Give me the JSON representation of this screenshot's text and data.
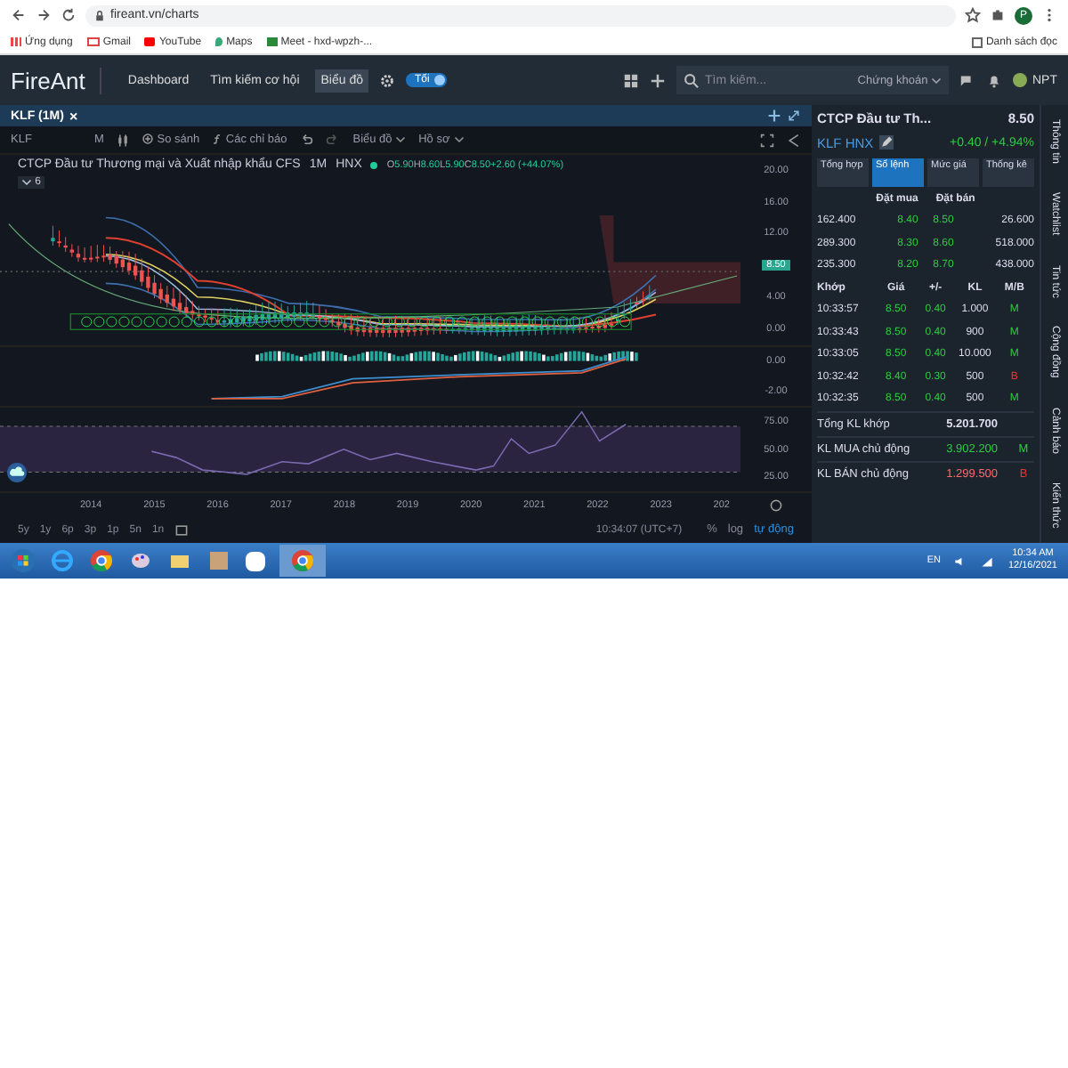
{
  "browser": {
    "url": "fireant.vn/charts",
    "profile": "P",
    "bookmarks": [
      {
        "label": "Ứng dụng",
        "kind": "apps"
      },
      {
        "label": "Gmail",
        "kind": "gmail"
      },
      {
        "label": "YouTube",
        "kind": "youtube"
      },
      {
        "label": "Maps",
        "kind": "maps"
      },
      {
        "label": "Meet - hxd-wpzh-...",
        "kind": "meet"
      }
    ],
    "reading_list": "Danh sách đọc"
  },
  "header": {
    "logo": "FireAnt",
    "nav": [
      {
        "label": "Dashboard",
        "selected": false
      },
      {
        "label": "Tìm kiếm cơ hội",
        "selected": false
      },
      {
        "label": "Biểu đồ",
        "selected": true
      }
    ],
    "theme_toggle": {
      "label": "Tối",
      "on": true
    },
    "search": {
      "placeholder": "Tìm kiếm..."
    },
    "market_select": "Chứng khoán",
    "user": "NPT"
  },
  "chart_tab": {
    "label": "KLF (1M)",
    "close": "×"
  },
  "toolbar": {
    "symbol": "KLF",
    "interval": "M",
    "compare": "So sánh",
    "indicators": "Các chỉ báo",
    "chart_type": "Biểu đồ",
    "profile": "Hồ sơ"
  },
  "chart": {
    "legend": {
      "title": "CTCP Đầu tư Thương mại và Xuất nhập khẩu CFS",
      "interval": "1M",
      "exchange": "HNX",
      "ohlc": [
        {
          "label": "O",
          "value": "5.90"
        },
        {
          "label": "H",
          "value": "8.60"
        },
        {
          "label": "L",
          "value": "5.90"
        },
        {
          "label": "C",
          "value": "8.50"
        }
      ],
      "change": "+2.60 (+44.07%)"
    },
    "collapse": "6",
    "price_axis": [
      {
        "label": "20.00",
        "kind": "tick"
      },
      {
        "label": "16.00",
        "kind": "tick"
      },
      {
        "label": "12.00",
        "kind": "tick"
      },
      {
        "label": "8.50",
        "kind": "current"
      },
      {
        "label": "4.00",
        "kind": "tick"
      },
      {
        "label": "0.00",
        "kind": "tick"
      }
    ],
    "macd_axis": [
      "0.00",
      "-2.00"
    ],
    "rsi_axis": [
      "75.00",
      "50.00",
      "25.00"
    ],
    "time_axis": [
      "2014",
      "2015",
      "2016",
      "2017",
      "2018",
      "2019",
      "2020",
      "2021",
      "2022",
      "2023",
      "202"
    ]
  },
  "bottom_bar": {
    "ranges": [
      "5y",
      "1y",
      "6p",
      "3p",
      "1p",
      "5n",
      "1n"
    ],
    "clock": "10:34:07 (UTC+7)",
    "options": [
      {
        "label": "%",
        "selected": false
      },
      {
        "label": "log",
        "selected": false
      },
      {
        "label": "tự động",
        "selected": true
      }
    ]
  },
  "panel": {
    "name": "CTCP Đầu tư Th...",
    "price": "8.50",
    "symbol": "KLF HNX",
    "change": "+0.40 / +4.94%",
    "tabs": [
      {
        "label": "Tổng hợp",
        "selected": false
      },
      {
        "label": "Sổ lệnh",
        "selected": true
      },
      {
        "label": "Mức giá",
        "selected": false
      },
      {
        "label": "Thống kê",
        "selected": false
      }
    ],
    "book_headers": [
      "Đặt mua",
      "Đặt bán"
    ],
    "book": [
      {
        "bid_volume": "162.400",
        "bid": "8.40",
        "ask": "8.50",
        "ask_volume": "26.600"
      },
      {
        "bid_volume": "289.300",
        "bid": "8.30",
        "ask": "8.60",
        "ask_volume": "518.000"
      },
      {
        "bid_volume": "235.300",
        "bid": "8.20",
        "ask": "8.70",
        "ask_volume": "438.000"
      }
    ],
    "trade_headers": [
      "Khớp",
      "Giá",
      "+/-",
      "KL",
      "M/B"
    ],
    "trades": [
      {
        "time": "10:33:57",
        "price": "8.50",
        "change": "0.40",
        "volume": "1.000",
        "side": "M"
      },
      {
        "time": "10:33:43",
        "price": "8.50",
        "change": "0.40",
        "volume": "900",
        "side": "M"
      },
      {
        "time": "10:33:05",
        "price": "8.50",
        "change": "0.40",
        "volume": "10.000",
        "side": "M"
      },
      {
        "time": "10:32:42",
        "price": "8.40",
        "change": "0.30",
        "volume": "500",
        "side": "B"
      },
      {
        "time": "10:32:35",
        "price": "8.50",
        "change": "0.40",
        "volume": "500",
        "side": "M"
      }
    ],
    "totals": [
      {
        "label": "Tổng KL khớp",
        "value": "5.201.700",
        "kind": "total"
      },
      {
        "label": "KL MUA chủ động",
        "value": "3.902.200",
        "side": "M",
        "kind": "buy"
      },
      {
        "label": "KL BÁN chủ động",
        "value": "1.299.500",
        "side": "B",
        "kind": "sell"
      }
    ]
  },
  "side_tabs": [
    "Thông tin",
    "Watchlist",
    "Tin tức",
    "Cộng đồng",
    "Cảnh báo",
    "Kiến thức"
  ],
  "taskbar": {
    "language": "EN",
    "time": "10:34 AM",
    "date": "12/16/2021"
  }
}
